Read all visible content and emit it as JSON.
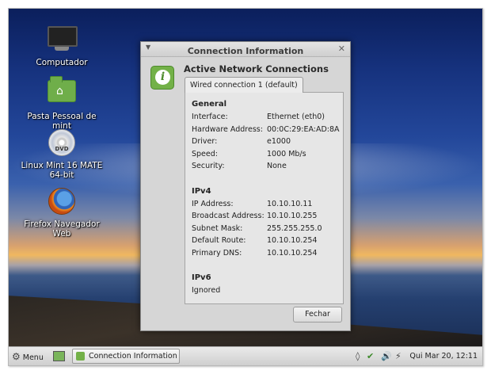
{
  "desktop": {
    "icons": [
      {
        "label": "Computador",
        "icon": "computer-icon"
      },
      {
        "label": "Pasta Pessoal de mint",
        "icon": "home-folder-icon"
      },
      {
        "label": "Linux Mint 16 MATE 64-bit",
        "icon": "dvd-icon",
        "badge": "DVD"
      },
      {
        "label": "Firefox Navegador Web",
        "icon": "firefox-icon"
      }
    ]
  },
  "dialog": {
    "title": "Connection Information",
    "heading": "Active Network Connections",
    "tab": "Wired connection 1 (default)",
    "sections": [
      {
        "title": "General",
        "rows": [
          {
            "key": "Interface:",
            "value": "Ethernet (eth0)"
          },
          {
            "key": "Hardware Address:",
            "value": "00:0C:29:EA:AD:8A"
          },
          {
            "key": "Driver:",
            "value": "e1000"
          },
          {
            "key": "Speed:",
            "value": "1000 Mb/s"
          },
          {
            "key": "Security:",
            "value": "None"
          }
        ]
      },
      {
        "title": "IPv4",
        "rows": [
          {
            "key": "IP Address:",
            "value": "10.10.10.11"
          },
          {
            "key": "Broadcast Address:",
            "value": "10.10.10.255"
          },
          {
            "key": "Subnet Mask:",
            "value": "255.255.255.0"
          },
          {
            "key": "Default Route:",
            "value": "10.10.10.254"
          },
          {
            "key": "Primary DNS:",
            "value": "10.10.10.254"
          }
        ]
      },
      {
        "title": "IPv6",
        "rows": [
          {
            "key": "Ignored",
            "value": ""
          }
        ]
      }
    ],
    "close_button": "Fechar"
  },
  "taskbar": {
    "menu_label": "Menu",
    "task_label": "Connection Information",
    "clock": "Qui Mar 20, 12:11"
  },
  "colors": {
    "accent_green": "#73b148",
    "dialog_bg": "#d6d6d6"
  }
}
